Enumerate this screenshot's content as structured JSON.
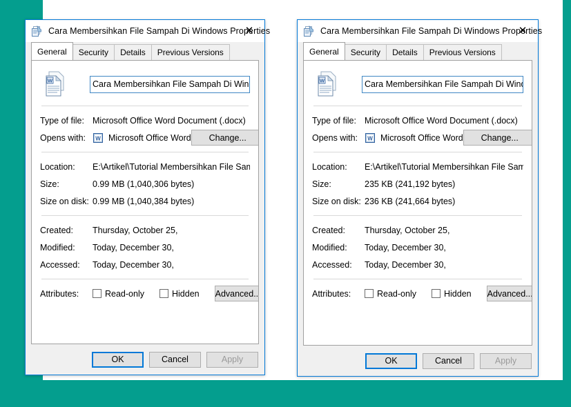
{
  "theme": {
    "background": "#049e8e",
    "sheet": "#ffffff",
    "dialog_face": "#f0f0f0",
    "accent_blue": "#0078d7",
    "textbox_border": "#3f87c4"
  },
  "dialogs": [
    {
      "id": "left",
      "title": "Cara Membersihkan File Sampah Di Windows Properties",
      "title_icon": "file-properties-icon",
      "close_label": "✕",
      "tabs": [
        {
          "label": "General",
          "active": true
        },
        {
          "label": "Security",
          "active": false
        },
        {
          "label": "Details",
          "active": false
        },
        {
          "label": "Previous Versions",
          "active": false
        }
      ],
      "doc_icon": "word-document-icon",
      "filename": {
        "value": "Cara Membersihkan File Sampah Di Windows",
        "caret_after": "Cara M",
        "before_caret": "Cara M",
        "after_caret": "embersihkan File Sampah Di Windows"
      },
      "fields": {
        "type_of_file_label": "Type of file:",
        "type_of_file_value": "Microsoft Office Word Document (.docx)",
        "opens_with_label": "Opens with:",
        "opens_with_app": "Microsoft Office Word",
        "opens_with_icon": "word-app-icon",
        "change_button": "Change...",
        "location_label": "Location:",
        "location_value": "E:\\Artikel\\Tutorial Membersihkan File Sampah Di Wi",
        "size_label": "Size:",
        "size_value": "0.99 MB (1,040,306 bytes)",
        "size_on_disk_label": "Size on disk:",
        "size_on_disk_value": "0.99 MB (1,040,384 bytes)",
        "created_label": "Created:",
        "created_value": "Thursday, October 25,",
        "modified_label": "Modified:",
        "modified_value": "Today, December 30,",
        "accessed_label": "Accessed:",
        "accessed_value": "Today, December 30,",
        "attributes_label": "Attributes:",
        "readonly_label": "Read-only",
        "readonly_checked": false,
        "hidden_label": "Hidden",
        "hidden_checked": false,
        "advanced_button": "Advanced..."
      },
      "footer": {
        "ok": "OK",
        "cancel": "Cancel",
        "apply": "Apply",
        "apply_disabled": true,
        "ok_is_default": true
      }
    },
    {
      "id": "right",
      "title": "Cara Membersihkan File Sampah Di Windows Properties",
      "title_icon": "file-properties-icon",
      "close_label": "✕",
      "tabs": [
        {
          "label": "General",
          "active": true
        },
        {
          "label": "Security",
          "active": false
        },
        {
          "label": "Details",
          "active": false
        },
        {
          "label": "Previous Versions",
          "active": false
        }
      ],
      "doc_icon": "word-document-icon",
      "filename": {
        "value": "Cara Membersihkan File Sampah Di Windows",
        "caret_after": "",
        "before_caret": "Cara Membersihkan File Sampah Di Windows",
        "after_caret": ""
      },
      "fields": {
        "type_of_file_label": "Type of file:",
        "type_of_file_value": "Microsoft Office Word Document (.docx)",
        "opens_with_label": "Opens with:",
        "opens_with_app": "Microsoft Office Word",
        "opens_with_icon": "word-app-icon",
        "change_button": "Change...",
        "location_label": "Location:",
        "location_value": "E:\\Artikel\\Tutorial Membersihkan File Sampah Di Wi",
        "size_label": "Size:",
        "size_value": "235 KB (241,192 bytes)",
        "size_on_disk_label": "Size on disk:",
        "size_on_disk_value": "236 KB (241,664 bytes)",
        "created_label": "Created:",
        "created_value": "Thursday, October 25,",
        "modified_label": "Modified:",
        "modified_value": "Today, December 30,",
        "accessed_label": "Accessed:",
        "accessed_value": "Today, December 30,",
        "attributes_label": "Attributes:",
        "readonly_label": "Read-only",
        "readonly_checked": false,
        "hidden_label": "Hidden",
        "hidden_checked": false,
        "advanced_button": "Advanced..."
      },
      "footer": {
        "ok": "OK",
        "cancel": "Cancel",
        "apply": "Apply",
        "apply_disabled": true,
        "ok_is_default": true
      }
    }
  ]
}
